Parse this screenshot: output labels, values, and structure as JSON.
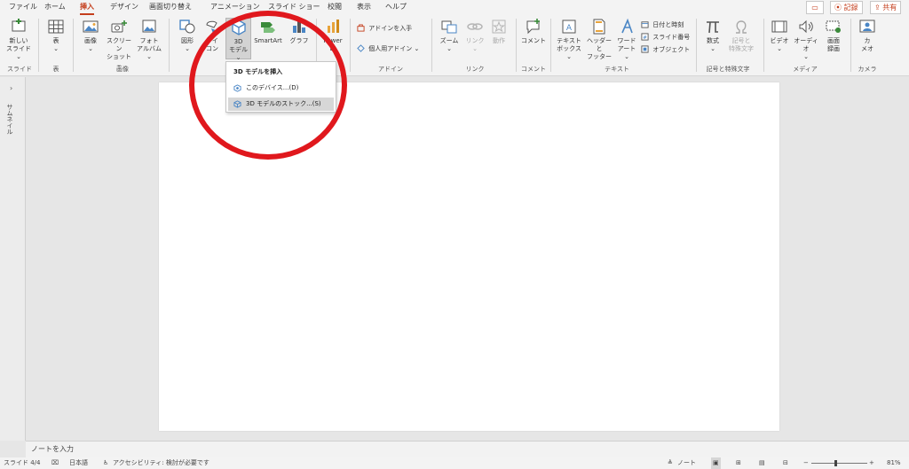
{
  "menu_tabs": [
    "ファイル",
    "ホーム",
    "挿入",
    "デザイン",
    "画面切り替え",
    "アニメーション",
    "スライド ショー",
    "校閲",
    "表示",
    "ヘルプ"
  ],
  "active_tab": "挿入",
  "title_bar": {
    "comment": "コメント",
    "record": "記録",
    "share": "共有"
  },
  "ribbon": {
    "new_slide": "新しい\nスライド ⌄",
    "table": "表\n⌄",
    "image": "画像\n⌄",
    "screenshot": "スクリーン\nショット ⌄",
    "photo_album": "フォト\nアルバム ⌄",
    "shapes": "図形\n⌄",
    "icons": "アイ\nコン",
    "model_3d": "3D\nモデル ⌄",
    "smartart": "SmartArt",
    "chart": "グラフ",
    "power_bi": "Power\nBI",
    "get_addins": "アドインを入手",
    "my_addins": "個人用アドイン ⌄",
    "zoom": "ズーム\n⌄",
    "link": "リンク\n⌄",
    "action": "動作",
    "comment": "コメント",
    "textbox": "テキスト\nボックス ⌄",
    "header_footer": "ヘッダーと\nフッター",
    "wordart": "ワード\nアート ⌄",
    "date_time": "日付と時刻",
    "slide_number": "スライド番号",
    "object": "オブジェクト",
    "equation": "数式\n⌄",
    "symbol": "記号と\n特殊文字",
    "video": "ビデオ\n⌄",
    "audio": "オーディオ\n⌄",
    "screen_recording": "画面\n録画",
    "cameo": "カ\nメオ"
  },
  "group_labels": {
    "slides": "スライド",
    "tables": "表",
    "images": "画像",
    "addins": "アドイン",
    "links": "リンク",
    "comments": "コメント",
    "text": "テキスト",
    "symbols": "記号と特殊文字",
    "media": "メディア",
    "camera": "カメラ"
  },
  "dropdown": {
    "header": "3D モデルを挿入",
    "items": [
      "このデバイス...(D)",
      "3D モデルのストック...(S)"
    ]
  },
  "thumbnail_label": "サムネイル",
  "notes_placeholder": "ノートを入力",
  "status": {
    "slide": "スライド 4/4",
    "language": "日本語",
    "accessibility": "アクセシビリティ: 検討が必要です",
    "notes": "ノート",
    "zoom": "81%"
  },
  "colors": {
    "accent": "#c43e1c",
    "annotation": "#e0181d"
  }
}
